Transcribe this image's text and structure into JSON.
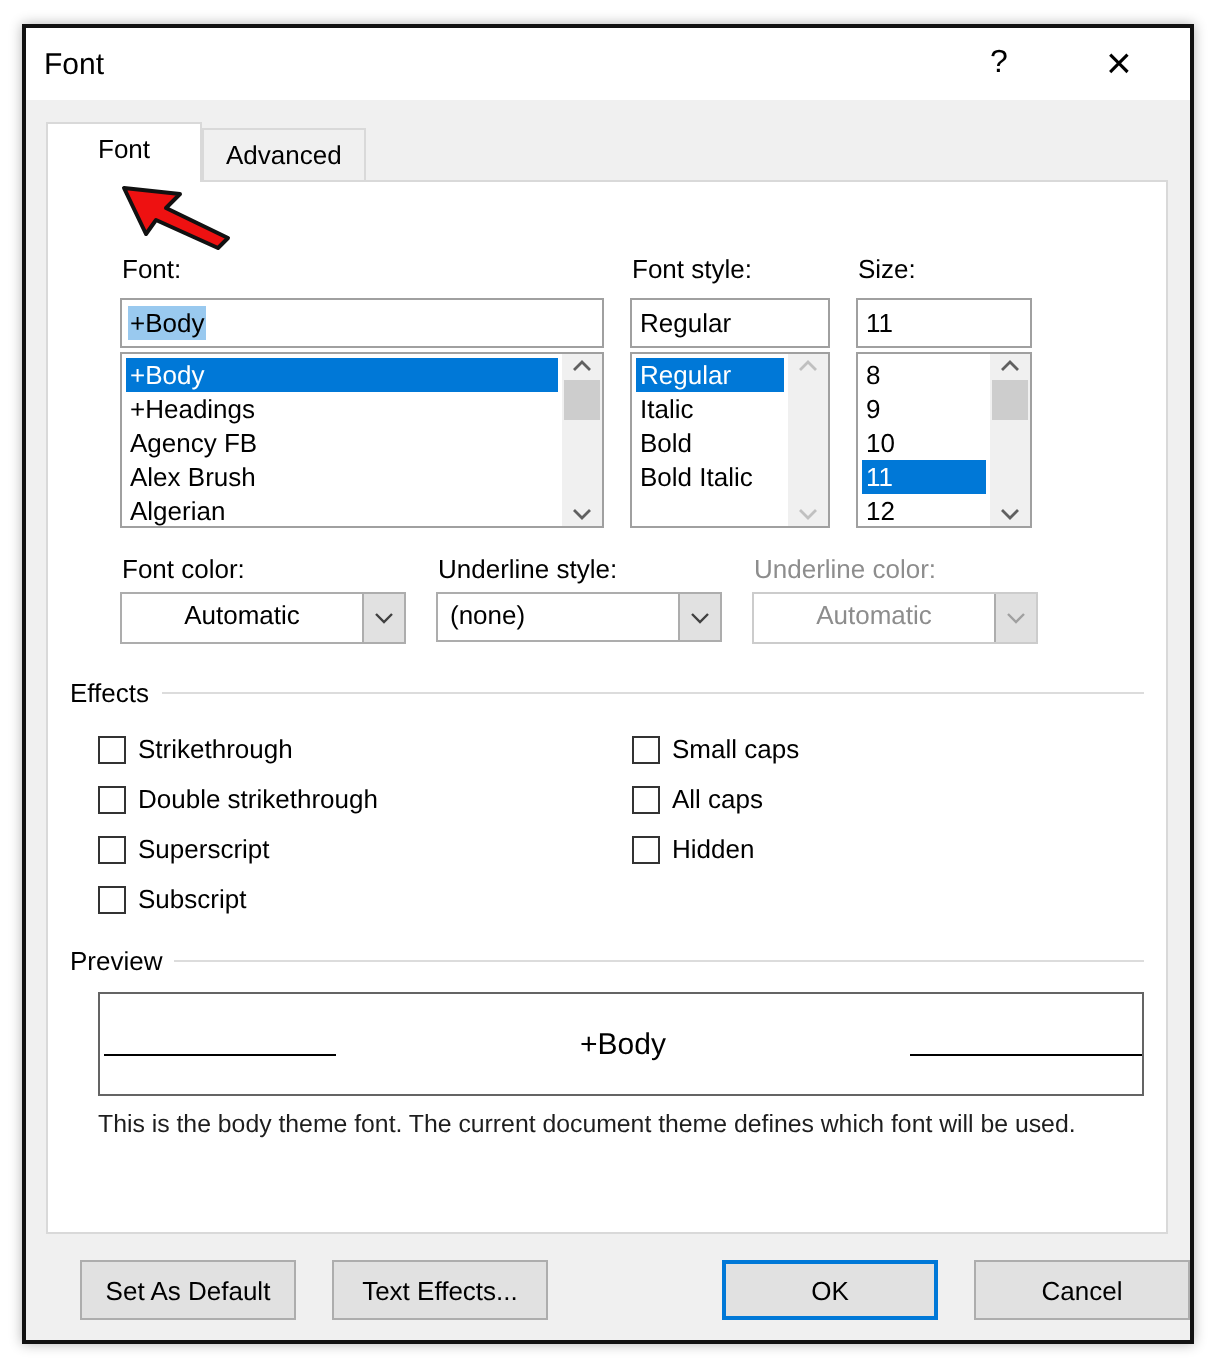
{
  "window": {
    "title": "Font",
    "help": "?",
    "close": "×"
  },
  "tabs": [
    {
      "label": "Font",
      "selected": true
    },
    {
      "label": "Advanced",
      "selected": false
    }
  ],
  "lists": [
    {
      "label": "Font:",
      "value": "+Body",
      "value_selected": true,
      "scrollable": true,
      "items": [
        {
          "label": "+Body",
          "selected": true
        },
        {
          "label": "+Headings",
          "selected": false
        },
        {
          "label": "Agency FB",
          "selected": false
        },
        {
          "label": "Alex Brush",
          "selected": false
        },
        {
          "label": "Algerian",
          "selected": false
        }
      ]
    },
    {
      "label": "Font style:",
      "value": "Regular",
      "value_selected": false,
      "scrollable": false,
      "items": [
        {
          "label": "Regular",
          "selected": true
        },
        {
          "label": "Italic",
          "selected": false
        },
        {
          "label": "Bold",
          "selected": false
        },
        {
          "label": "Bold Italic",
          "selected": false
        }
      ]
    },
    {
      "label": "Size:",
      "value": "11",
      "value_selected": false,
      "scrollable": true,
      "items": [
        {
          "label": "8",
          "selected": false
        },
        {
          "label": "9",
          "selected": false
        },
        {
          "label": "10",
          "selected": false
        },
        {
          "label": "11",
          "selected": true
        },
        {
          "label": "12",
          "selected": false
        }
      ]
    }
  ],
  "combos": [
    {
      "label": "Font color:",
      "value": "Automatic",
      "kind": "color",
      "disabled": false
    },
    {
      "label": "Underline style:",
      "value": "(none)",
      "kind": "style",
      "disabled": false
    },
    {
      "label": "Underline color:",
      "value": "Automatic",
      "kind": "color",
      "disabled": true
    }
  ],
  "effects": {
    "title": "Effects",
    "left": [
      {
        "label": "Strikethrough",
        "checked": false
      },
      {
        "label": "Double strikethrough",
        "checked": false
      },
      {
        "label": "Superscript",
        "checked": false
      },
      {
        "label": "Subscript",
        "checked": false
      }
    ],
    "right": [
      {
        "label": "Small caps",
        "checked": false
      },
      {
        "label": "All caps",
        "checked": false
      },
      {
        "label": "Hidden",
        "checked": false
      }
    ]
  },
  "preview": {
    "title": "Preview",
    "sample": "+Body",
    "description": "This is the body theme font. The current document theme defines which font will be used."
  },
  "buttons": [
    {
      "label": "Set As Default",
      "default": false
    },
    {
      "label": "Text Effects...",
      "default": false
    },
    {
      "label": "OK",
      "default": true
    },
    {
      "label": "Cancel",
      "default": false
    }
  ],
  "annotation": {
    "kind": "arrow"
  }
}
